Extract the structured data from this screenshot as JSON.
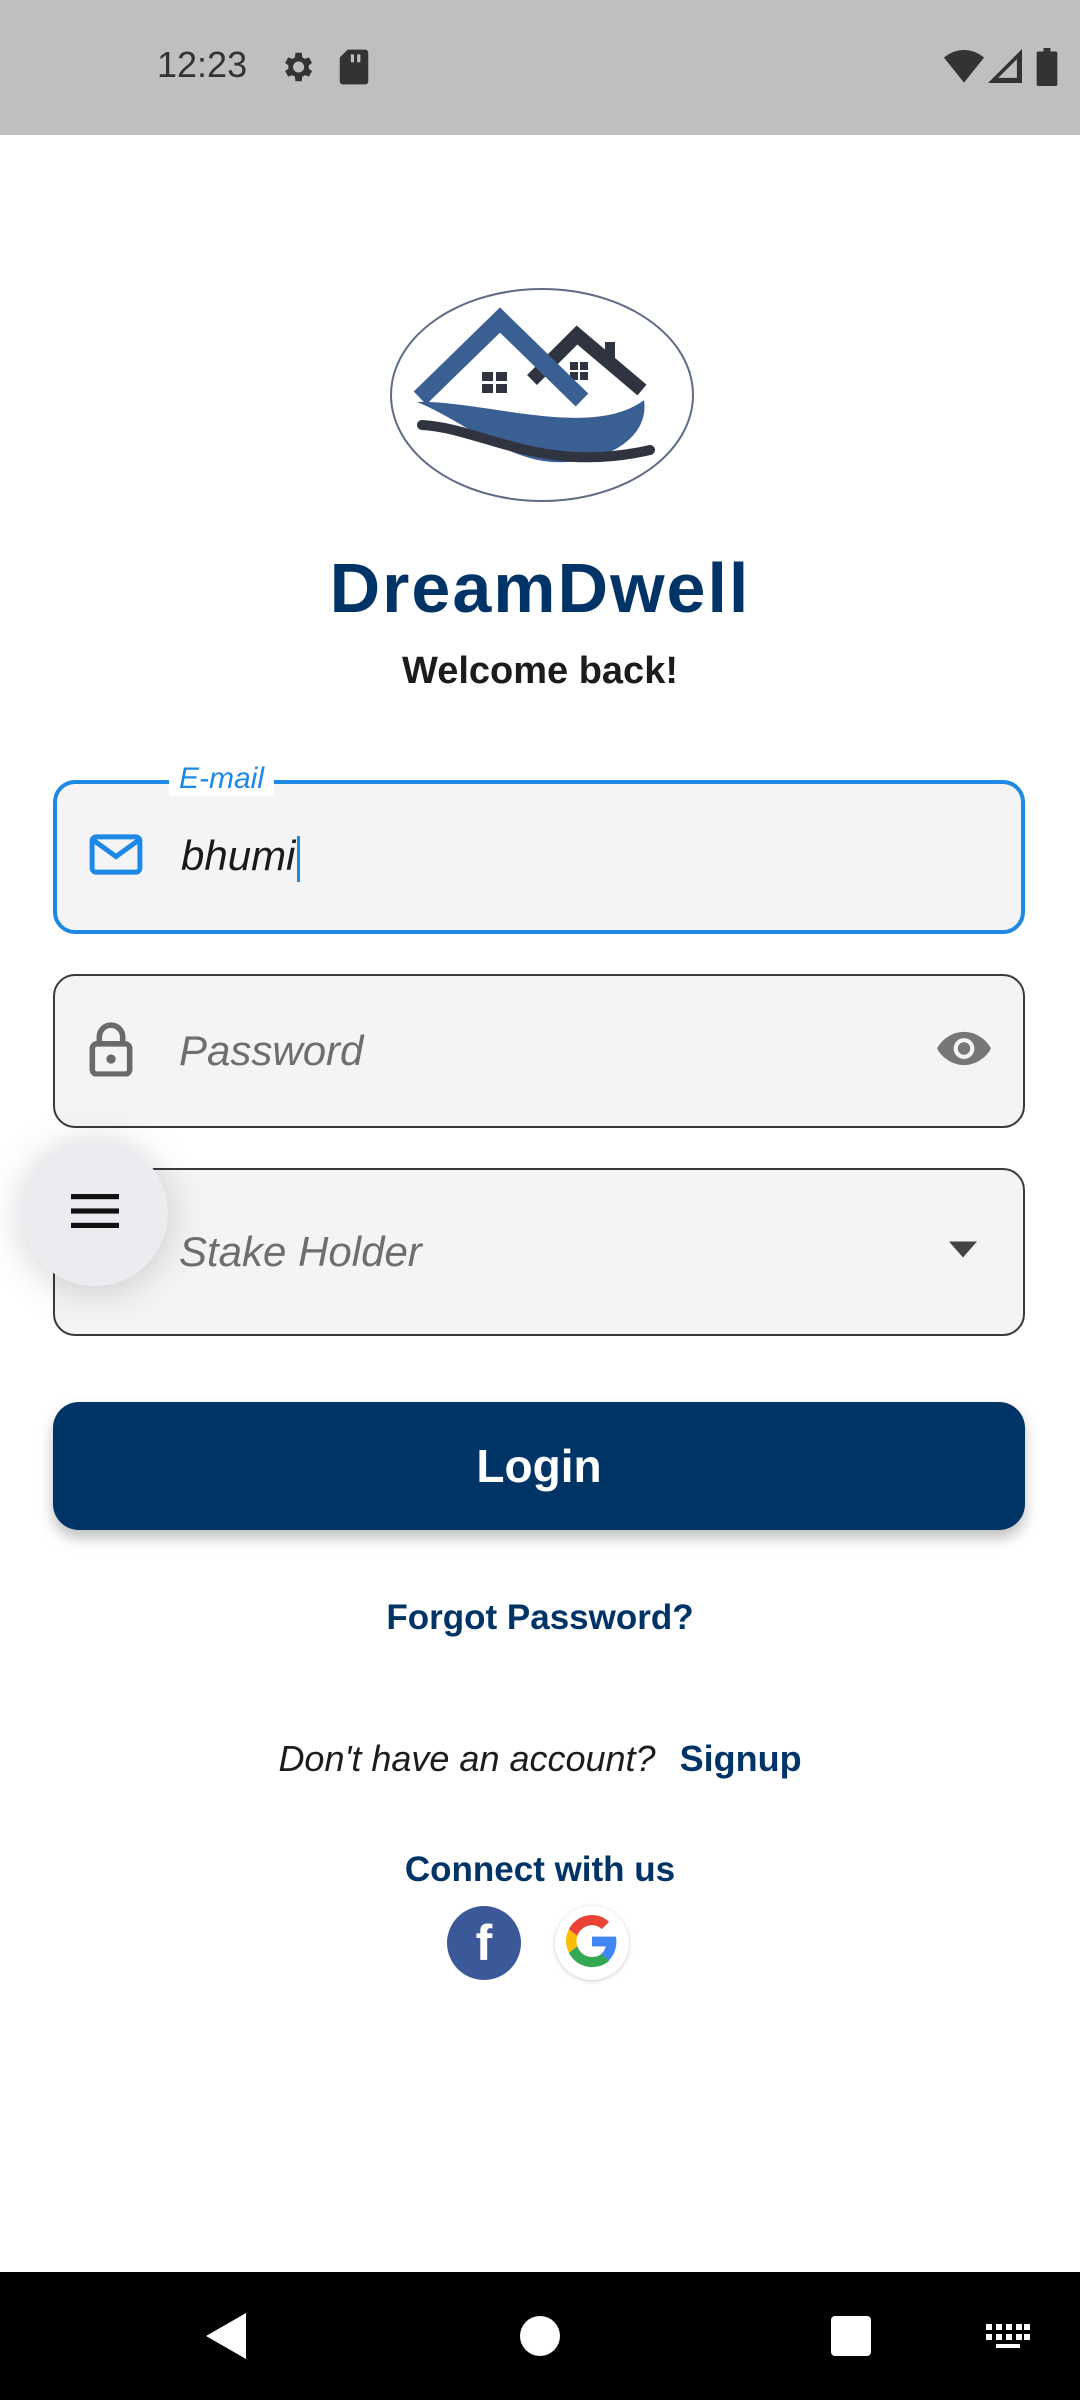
{
  "status_bar": {
    "time": "12:23"
  },
  "app": {
    "title": "DreamDwell",
    "welcome": "Welcome back!"
  },
  "form": {
    "email": {
      "label": "E-mail",
      "value": "bhumi"
    },
    "password": {
      "placeholder": "Password"
    },
    "stakeholder": {
      "placeholder": "Stake Holder"
    },
    "login_label": "Login",
    "forgot_label": "Forgot Password?",
    "no_account_text": "Don't have an account?",
    "signup_label": "Signup",
    "connect_label": "Connect with us"
  },
  "social": {
    "facebook_glyph": "f"
  },
  "colors": {
    "primary": "#003366",
    "focus": "#1e88e5",
    "facebook": "#3b5998"
  },
  "icons": [
    "settings-icon",
    "sd-card-icon",
    "wifi-icon",
    "signal-icon",
    "battery-icon",
    "mail-icon",
    "lock-icon",
    "eye-icon",
    "dropdown-arrow-icon",
    "menu-icon",
    "facebook-icon",
    "google-icon",
    "back-icon",
    "home-icon",
    "recents-icon",
    "keyboard-icon"
  ]
}
